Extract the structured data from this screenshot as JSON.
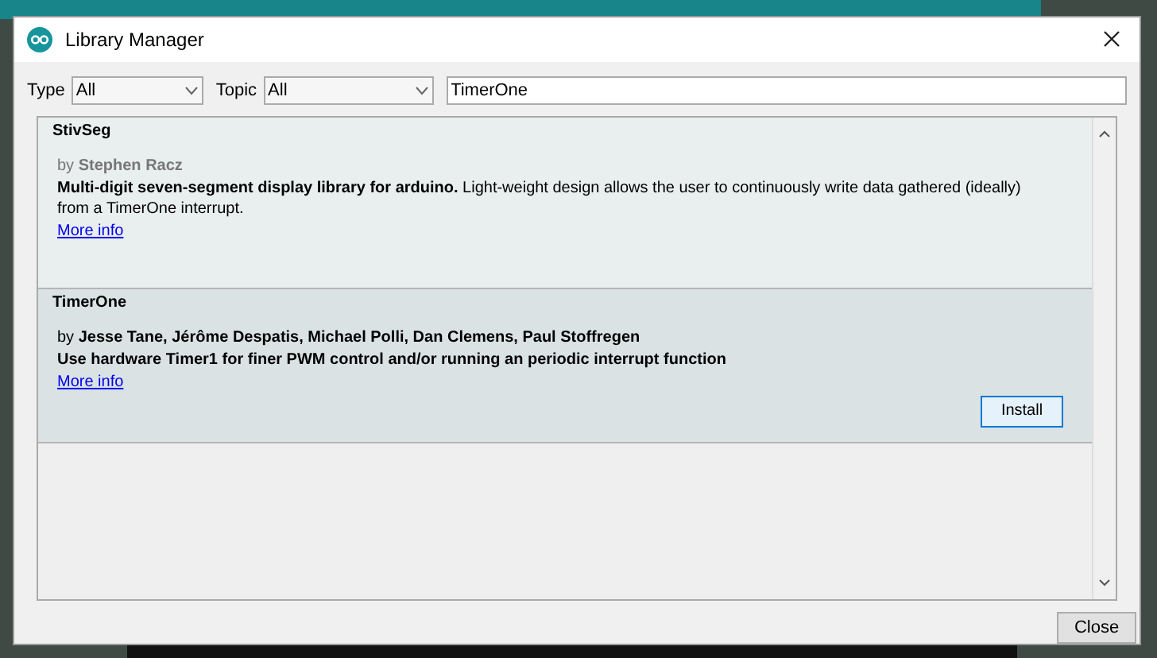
{
  "window": {
    "title": "Library Manager"
  },
  "filters": {
    "type_label": "Type",
    "type_value": "All",
    "topic_label": "Topic",
    "topic_value": "All",
    "search_value": "TimerOne"
  },
  "libraries": [
    {
      "name": "StivSeg",
      "by": "by",
      "authors": "Stephen Racz",
      "description": "**Multi-digit seven-segment display library for arduino.** Light-weight design allows the user to continuously write data gathered (ideally) from a TimerOne interrupt.",
      "more_info": "More info",
      "selected": false
    },
    {
      "name": "TimerOne",
      "by": "by",
      "authors": "Jesse Tane, Jérôme Despatis, Michael Polli, Dan Clemens, Paul Stoffregen",
      "description": "**Use hardware Timer1 for finer PWM control and/or running an periodic interrupt function**",
      "more_info": "More info",
      "selected": true,
      "install_button": "Install"
    }
  ],
  "close_button": "Close"
}
